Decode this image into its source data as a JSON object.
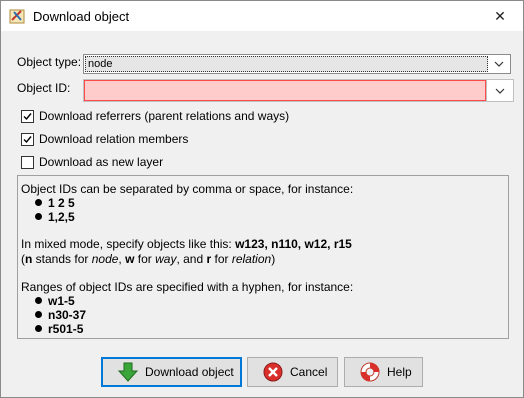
{
  "window": {
    "title": "Download object",
    "close_glyph": "✕"
  },
  "form": {
    "object_type_label": "Object type:",
    "object_type_value": "node",
    "object_id_label": "Object ID:",
    "object_id_value": ""
  },
  "options": [
    {
      "label": "Download referrers (parent relations and ways)",
      "checked": true
    },
    {
      "label": "Download relation members",
      "checked": true
    },
    {
      "label": "Download as new layer",
      "checked": false
    }
  ],
  "info": {
    "intro": "Object IDs can be separated by comma or space, for instance:",
    "examples1": [
      "1 2 5",
      "1,2,5"
    ],
    "mixed_prefix": "In mixed mode, specify objects like this: ",
    "mixed_example": "w123, n110, w12, r15",
    "legend": {
      "open": "(",
      "n": "n",
      "t1": " stands for ",
      "node": "node",
      "c1": ", ",
      "w": "w",
      "t2": " for ",
      "way": "way",
      "c2": ", and ",
      "r": "r",
      "t3": " for ",
      "relation": "relation",
      "close": ")"
    },
    "ranges_intro": "Ranges of object IDs are specified with a hyphen, for instance:",
    "examples2": [
      "w1-5",
      "n30-37",
      "r501-5"
    ]
  },
  "buttons": {
    "download": "Download object",
    "cancel": "Cancel",
    "help": "Help"
  },
  "colors": {
    "error_field_bg": "#ffcccc",
    "error_field_border": "#ff4a4a",
    "primary_border": "#0078d7"
  },
  "icons": [
    "josm-app-icon",
    "close-icon",
    "chevron-down-icon",
    "checkmark-icon",
    "download-arrow-icon",
    "cancel-icon",
    "help-lifebuoy-icon"
  ]
}
